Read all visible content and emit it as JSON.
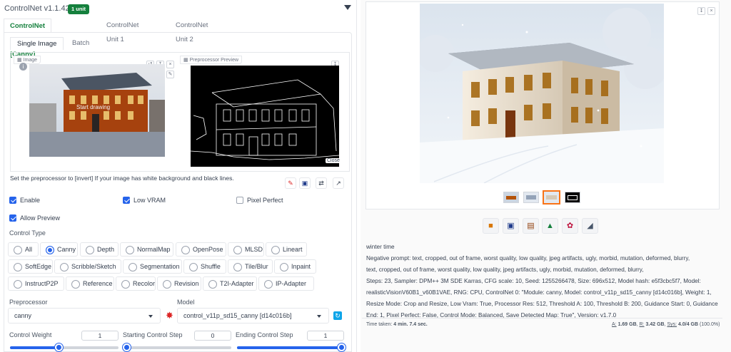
{
  "controlnet": {
    "title": "ControlNet v1.1.423",
    "badge": "1 unit",
    "unit_tabs": [
      "ControlNet Unit 0 [Canny]",
      "ControlNet Unit 1",
      "ControlNet Unit 2"
    ],
    "image_tabs": [
      "Single Image",
      "Batch"
    ],
    "image_label": "Image",
    "start_drawing": "Start drawing",
    "preview_label": "Preprocessor Preview",
    "close_label": "Close",
    "hint": "Set the preprocessor to [invert] If your image has white background and black lines.",
    "checkboxes": {
      "enable": "Enable",
      "low_vram": "Low VRAM",
      "pixel_perfect": "Pixel Perfect",
      "allow_preview": "Allow Preview"
    },
    "control_type_label": "Control Type",
    "control_types": [
      "All",
      "Canny",
      "Depth",
      "NormalMap",
      "OpenPose",
      "MLSD",
      "Lineart",
      "SoftEdge",
      "Scribble/Sketch",
      "Segmentation",
      "Shuffle",
      "Tile/Blur",
      "Inpaint",
      "InstructP2P",
      "Reference",
      "Recolor",
      "Revision",
      "T2I-Adapter",
      "IP-Adapter"
    ],
    "selected_control_type": "Canny",
    "preprocessor_label": "Preprocessor",
    "preprocessor_value": "canny",
    "model_label": "Model",
    "model_value": "control_v11p_sd15_canny [d14c016b]",
    "sliders": {
      "weight": {
        "label": "Control Weight",
        "value": "1",
        "fraction": 0.45
      },
      "start": {
        "label": "Starting Control Step",
        "value": "0",
        "fraction": 0.0
      },
      "end": {
        "label": "Ending Control Step",
        "value": "1",
        "fraction": 1.0
      }
    }
  },
  "output": {
    "prompt": "winter time",
    "info_lines": [
      "Negative prompt: text, cropped, out of frame, worst quality, low quality, jpeg artifacts, ugly, morbid, mutation, deformed, blurry,",
      "text, cropped, out of frame, worst quality, low quality, jpeg artifacts, ugly, morbid, mutation, deformed, blurry,",
      "Steps: 23, Sampler: DPM++ 3M SDE Karras, CFG scale: 10, Seed: 1255266478, Size: 696x512, Model hash: e5f3cbc5f7, Model:",
      "realisticVisionV60B1_v60B1VAE, RNG: CPU, ControlNet 0: \"Module: canny, Model: control_v11p_sd15_canny [d14c016b], Weight: 1,",
      "Resize Mode: Crop and Resize, Low Vram: True, Processor Res: 512, Threshold A: 100, Threshold B: 200, Guidance Start: 0, Guidance",
      "End: 1, Pixel Perfect: False, Control Mode: Balanced, Save Detected Map: True\", Version: v1.7.0"
    ],
    "time_label": "Time taken:",
    "time_value": "4 min. 7.4 sec.",
    "vram": {
      "a_label": "A:",
      "a_value": "1.69 GB",
      "r_label": "R:",
      "r_value": "3.42 GB",
      "sys_label": "Sys:",
      "sys_value": "4.0/4 GB",
      "sys_pct": "(100.0%)"
    },
    "action_icons": [
      "folder-icon",
      "save-icon",
      "zip-icon",
      "send-to-img2img-icon",
      "send-to-inpaint-icon",
      "send-to-extras-icon"
    ]
  }
}
